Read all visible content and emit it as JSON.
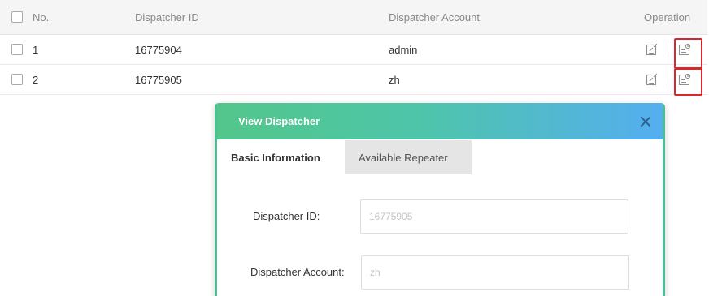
{
  "table": {
    "columns": {
      "no": "No.",
      "dispatcher_id": "Dispatcher ID",
      "dispatcher_account": "Dispatcher Account",
      "operation": "Operation"
    },
    "rows": [
      {
        "no": "1",
        "dispatcher_id": "16775904",
        "dispatcher_account": "admin",
        "edit_icon": "edit-icon",
        "view_icon": "view-details-icon"
      },
      {
        "no": "2",
        "dispatcher_id": "16775905",
        "dispatcher_account": "zh",
        "edit_icon": "edit-icon",
        "view_icon": "view-details-icon"
      }
    ]
  },
  "modal": {
    "title": "View Dispatcher",
    "close_icon": "close-icon",
    "tabs": [
      {
        "label": "Basic Information",
        "active": true
      },
      {
        "label": "Available Repeater",
        "active": false
      }
    ],
    "fields": {
      "dispatcher_id_label": "Dispatcher ID:",
      "dispatcher_id_value": "16775905",
      "dispatcher_account_label": "Dispatcher Account:",
      "dispatcher_account_value": "zh"
    }
  },
  "colors": {
    "highlight": "#d9272e",
    "modal_gradient_start": "#52c68a",
    "modal_gradient_end": "#55aef0",
    "modal_border": "#4cbf92",
    "header_bg": "#f5f5f5"
  }
}
